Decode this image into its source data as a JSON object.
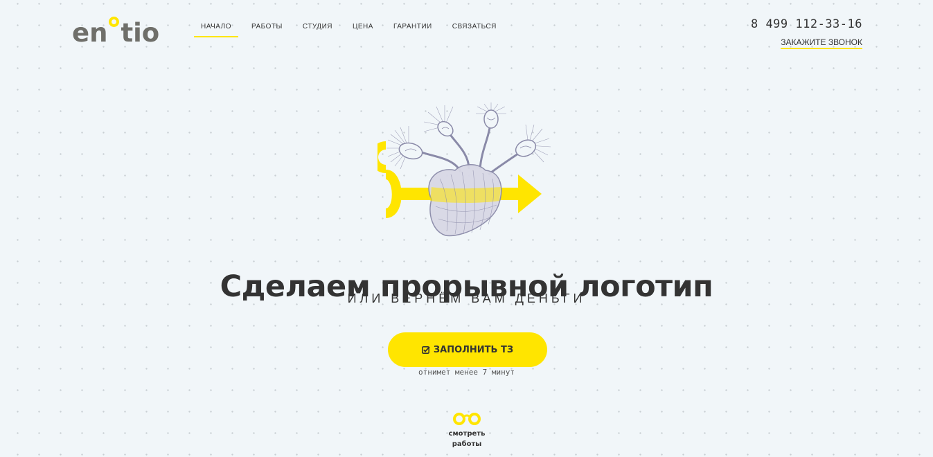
{
  "logo": {
    "part1": "en",
    "part2": "tio"
  },
  "nav": {
    "items": [
      {
        "label": "Начало",
        "active": true
      },
      {
        "label": "Работы",
        "active": false
      },
      {
        "label": "Студия",
        "active": false
      },
      {
        "label": "Цена",
        "active": false
      },
      {
        "label": "Гарантии",
        "active": false
      },
      {
        "label": "Связаться",
        "active": false
      }
    ]
  },
  "contact": {
    "phone": "8 499 112-33-16",
    "callback_label": "Закажите звонок"
  },
  "hero": {
    "illustration_icon": "heart-lightbulbs-illustration",
    "headline": "Сделаем прорывной логотип",
    "subheadline": "или вернём вам деньги"
  },
  "cta": {
    "icon": "check-square-icon",
    "label": "Заполнить ТЗ",
    "note": "отнимет менее 7 минут"
  },
  "works": {
    "icon": "binoculars-icon",
    "label_line1": "смотреть",
    "label_line2": "работы"
  },
  "colors": {
    "accent": "#ffe500",
    "text": "#333333",
    "logo_gray": "#6f6f6a",
    "background": "#f1f6f9",
    "illustration": "#8a8aa8"
  }
}
